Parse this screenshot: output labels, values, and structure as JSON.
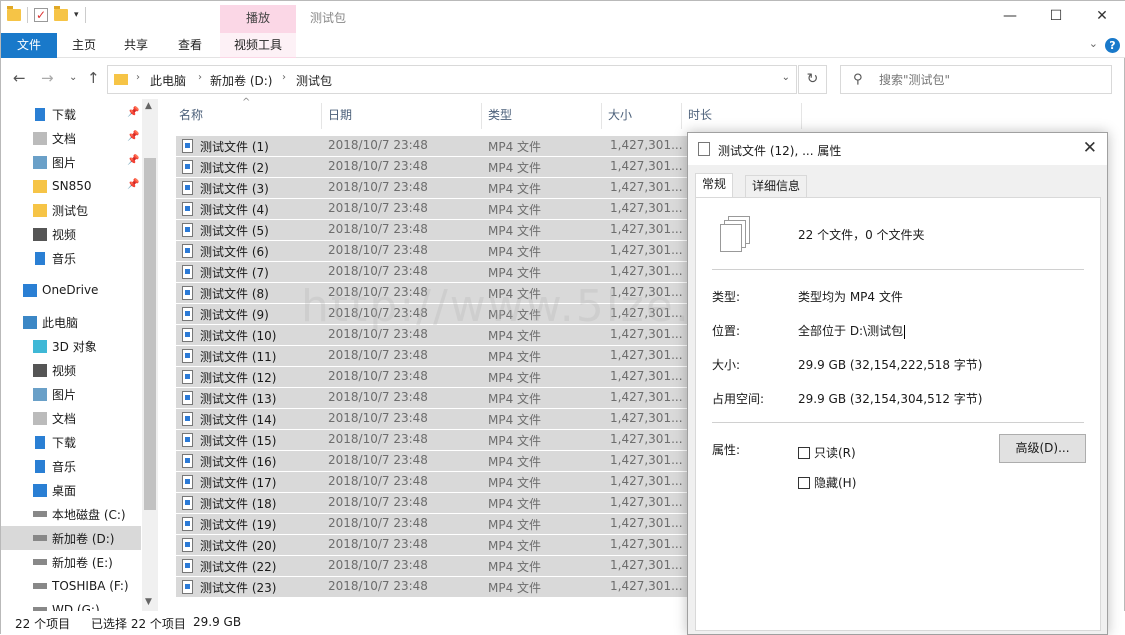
{
  "titlebar": {
    "context_tab": "播放",
    "title": "测试包",
    "minimize": "—",
    "maximize": "☐",
    "close": "✕"
  },
  "ribbon": {
    "tabs": [
      "文件",
      "主页",
      "共享",
      "查看",
      "视频工具"
    ],
    "help": "?"
  },
  "address": {
    "crumbs": [
      "此电脑",
      "新加卷 (D:)",
      "测试包"
    ],
    "search_placeholder": "搜索\"测试包\""
  },
  "nav": {
    "items": [
      {
        "label": "下载",
        "icon": "download-icon",
        "pinned": true
      },
      {
        "label": "文档",
        "icon": "document-icon",
        "pinned": true
      },
      {
        "label": "图片",
        "icon": "picture-icon",
        "pinned": true
      },
      {
        "label": "SN850",
        "icon": "folder-icon",
        "pinned": true
      },
      {
        "label": "测试包",
        "icon": "folder-icon",
        "pinned": false
      },
      {
        "label": "视频",
        "icon": "video-icon",
        "pinned": false
      },
      {
        "label": "音乐",
        "icon": "music-icon",
        "pinned": false
      },
      {
        "label": "OneDrive",
        "icon": "cloud-icon",
        "pinned": false
      },
      {
        "label": "此电脑",
        "icon": "computer-icon",
        "pinned": false
      },
      {
        "label": "3D 对象",
        "icon": "3d-objects-icon",
        "pinned": false
      },
      {
        "label": "视频",
        "icon": "video-icon",
        "pinned": false
      },
      {
        "label": "图片",
        "icon": "picture-icon",
        "pinned": false
      },
      {
        "label": "文档",
        "icon": "document-icon",
        "pinned": false
      },
      {
        "label": "下载",
        "icon": "download-icon",
        "pinned": false
      },
      {
        "label": "音乐",
        "icon": "music-icon",
        "pinned": false
      },
      {
        "label": "桌面",
        "icon": "desktop-icon",
        "pinned": false
      },
      {
        "label": "本地磁盘 (C:)",
        "icon": "drive-icon",
        "pinned": false
      },
      {
        "label": "新加卷 (D:)",
        "icon": "drive-icon",
        "pinned": false,
        "selected": true
      },
      {
        "label": "新加卷 (E:)",
        "icon": "drive-icon",
        "pinned": false
      },
      {
        "label": "TOSHIBA (F:)",
        "icon": "drive-icon",
        "pinned": false
      },
      {
        "label": "WD (G:)",
        "icon": "drive-icon",
        "pinned": false
      }
    ]
  },
  "columns": {
    "name": "名称",
    "date": "日期",
    "type": "类型",
    "size": "大小",
    "length": "时长"
  },
  "files": [
    {
      "name": "测试文件 (1)",
      "date": "2018/10/7 23:48",
      "type": "MP4 文件",
      "size": "1,427,301..."
    },
    {
      "name": "测试文件 (2)",
      "date": "2018/10/7 23:48",
      "type": "MP4 文件",
      "size": "1,427,301..."
    },
    {
      "name": "测试文件 (3)",
      "date": "2018/10/7 23:48",
      "type": "MP4 文件",
      "size": "1,427,301..."
    },
    {
      "name": "测试文件 (4)",
      "date": "2018/10/7 23:48",
      "type": "MP4 文件",
      "size": "1,427,301..."
    },
    {
      "name": "测试文件 (5)",
      "date": "2018/10/7 23:48",
      "type": "MP4 文件",
      "size": "1,427,301..."
    },
    {
      "name": "测试文件 (6)",
      "date": "2018/10/7 23:48",
      "type": "MP4 文件",
      "size": "1,427,301..."
    },
    {
      "name": "测试文件 (7)",
      "date": "2018/10/7 23:48",
      "type": "MP4 文件",
      "size": "1,427,301..."
    },
    {
      "name": "测试文件 (8)",
      "date": "2018/10/7 23:48",
      "type": "MP4 文件",
      "size": "1,427,301..."
    },
    {
      "name": "测试文件 (9)",
      "date": "2018/10/7 23:48",
      "type": "MP4 文件",
      "size": "1,427,301..."
    },
    {
      "name": "测试文件 (10)",
      "date": "2018/10/7 23:48",
      "type": "MP4 文件",
      "size": "1,427,301..."
    },
    {
      "name": "测试文件 (11)",
      "date": "2018/10/7 23:48",
      "type": "MP4 文件",
      "size": "1,427,301..."
    },
    {
      "name": "测试文件 (12)",
      "date": "2018/10/7 23:48",
      "type": "MP4 文件",
      "size": "1,427,301..."
    },
    {
      "name": "测试文件 (13)",
      "date": "2018/10/7 23:48",
      "type": "MP4 文件",
      "size": "1,427,301..."
    },
    {
      "name": "测试文件 (14)",
      "date": "2018/10/7 23:48",
      "type": "MP4 文件",
      "size": "1,427,301..."
    },
    {
      "name": "测试文件 (15)",
      "date": "2018/10/7 23:48",
      "type": "MP4 文件",
      "size": "1,427,301..."
    },
    {
      "name": "测试文件 (16)",
      "date": "2018/10/7 23:48",
      "type": "MP4 文件",
      "size": "1,427,301..."
    },
    {
      "name": "测试文件 (17)",
      "date": "2018/10/7 23:48",
      "type": "MP4 文件",
      "size": "1,427,301..."
    },
    {
      "name": "测试文件 (18)",
      "date": "2018/10/7 23:48",
      "type": "MP4 文件",
      "size": "1,427,301..."
    },
    {
      "name": "测试文件 (19)",
      "date": "2018/10/7 23:48",
      "type": "MP4 文件",
      "size": "1,427,301..."
    },
    {
      "name": "测试文件 (20)",
      "date": "2018/10/7 23:48",
      "type": "MP4 文件",
      "size": "1,427,301..."
    },
    {
      "name": "测试文件 (22)",
      "date": "2018/10/7 23:48",
      "type": "MP4 文件",
      "size": "1,427,301..."
    },
    {
      "name": "测试文件 (23)",
      "date": "2018/10/7 23:48",
      "type": "MP4 文件",
      "size": "1,427,301..."
    }
  ],
  "status": {
    "count": "22 个项目",
    "selected": "已选择 22 个项目",
    "size": "29.9 GB"
  },
  "watermark": "http://www.5Ize.com",
  "dialog": {
    "title": "测试文件 (12), ... 属性",
    "close": "✕",
    "tabs": [
      "常规",
      "详细信息"
    ],
    "summary": "22 个文件，0 个文件夹",
    "type_label": "类型:",
    "type_value": "类型均为 MP4 文件",
    "location_label": "位置:",
    "location_value": "全部位于 D:\\测试包",
    "size_label": "大小:",
    "size_value": "29.9 GB (32,154,222,518 字节)",
    "disk_label": "占用空间:",
    "disk_value": "29.9 GB (32,154,304,512 字节)",
    "attr_label": "属性:",
    "readonly_label": "只读(R)",
    "hidden_label": "隐藏(H)",
    "advanced_label": "高级(D)..."
  },
  "colors": {
    "accent": "#1979ca",
    "context_tab": "#fbd7e6",
    "selection": "#d9d9d9"
  }
}
